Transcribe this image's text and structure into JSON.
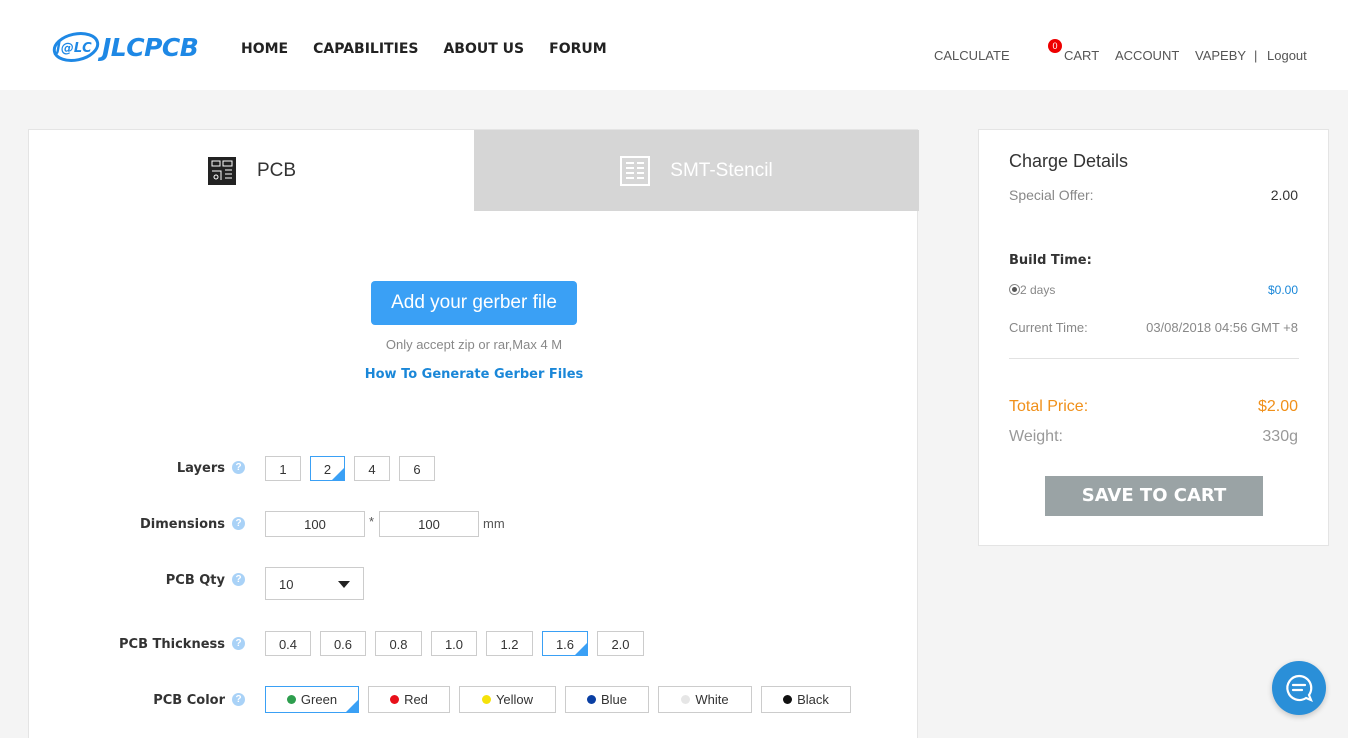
{
  "header": {
    "brand": "JLCPCB",
    "logo_mark": "J@LC",
    "nav": [
      "HOME",
      "CAPABILITIES",
      "ABOUT US",
      "FORUM"
    ],
    "calculate": "CALCULATE",
    "cart_count": "0",
    "cart": "CART",
    "account": "ACCOUNT",
    "username": "VAPEBY",
    "separator": "|",
    "logout": "Logout"
  },
  "tabs": {
    "pcb": "PCB",
    "smt": "SMT-Stencil"
  },
  "upload": {
    "button": "Add your gerber file",
    "note": "Only accept zip or rar,Max 4 M",
    "link": "How To Generate Gerber Files"
  },
  "form": {
    "help_glyph": "?",
    "layers": {
      "label": "Layers",
      "options": [
        "1",
        "2",
        "4",
        "6"
      ],
      "selected": "2"
    },
    "dimensions": {
      "label": "Dimensions",
      "width": "100",
      "times": "*",
      "height": "100",
      "unit": "mm"
    },
    "qty": {
      "label": "PCB Qty",
      "value": "10"
    },
    "thickness": {
      "label": "PCB Thickness",
      "options": [
        "0.4",
        "0.6",
        "0.8",
        "1.0",
        "1.2",
        "1.6",
        "2.0"
      ],
      "selected": "1.6"
    },
    "color": {
      "label": "PCB Color",
      "options": [
        {
          "name": "Green",
          "hex": "#2e9e4e"
        },
        {
          "name": "Red",
          "hex": "#e8101a"
        },
        {
          "name": "Yellow",
          "hex": "#f5e20a"
        },
        {
          "name": "Blue",
          "hex": "#0a3fa3"
        },
        {
          "name": "White",
          "hex": "#e6e6e6"
        },
        {
          "name": "Black",
          "hex": "#111111"
        }
      ],
      "selected": "Green"
    }
  },
  "charge": {
    "title": "Charge Details",
    "special_offer_label": "Special Offer:",
    "special_offer_value": "2.00",
    "build_time_label": "Build Time:",
    "build_option": "2 days",
    "build_price": "$0.00",
    "current_time_label": "Current Time:",
    "current_time_value": "03/08/2018 04:56 GMT +8",
    "total_label": "Total Price:",
    "total_value": "$2.00",
    "weight_label": "Weight:",
    "weight_value": "330g",
    "save_button": "SAVE TO CART"
  },
  "colors": {
    "accent": "#3aa0f5",
    "orange": "#f0901a",
    "link": "#1a87d8"
  }
}
